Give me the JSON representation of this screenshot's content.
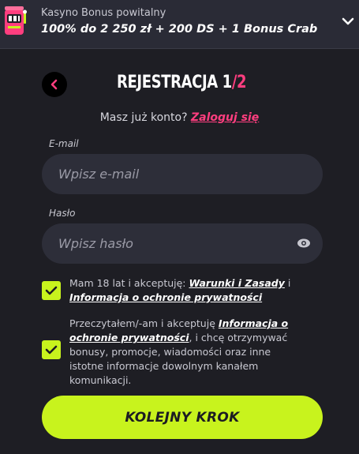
{
  "banner": {
    "subtitle": "Kasyno Bonus powitalny",
    "offer": "100% do 2 250 zł + 200 DS + 1 Bonus Crab"
  },
  "header": {
    "title": "REJESTRACJA ",
    "step": "1",
    "total": "/2"
  },
  "login": {
    "prompt": "Masz już konto? ",
    "link": "Zaloguj się"
  },
  "form": {
    "email_label": "E-mail",
    "email_placeholder": "Wpisz e-mail",
    "password_label": "Hasło",
    "password_placeholder": "Wpisz hasło"
  },
  "consents": [
    {
      "checked": true,
      "text_before": "Mam 18 lat i akceptuję: ",
      "link1": "Warunki i Zasady",
      "mid": " i ",
      "link2": "Informacja o ochronie prywatności"
    },
    {
      "checked": true,
      "text_before": "Przeczytałem/-am i akceptuję ",
      "link": "Informacja o ochronie prywatności",
      "text_after": ", i chcę otrzymywać bonusy, promocje, wiadomości oraz inne istotne informacje dowolnym kanałem komunikacji."
    }
  ],
  "cta": {
    "label": "KOLEJNY KROK"
  },
  "colors": {
    "accent_pink": "#ff3e7f",
    "accent_lime": "#c8f31d",
    "background": "#1e1e24",
    "input_bg": "#2d2e39"
  }
}
